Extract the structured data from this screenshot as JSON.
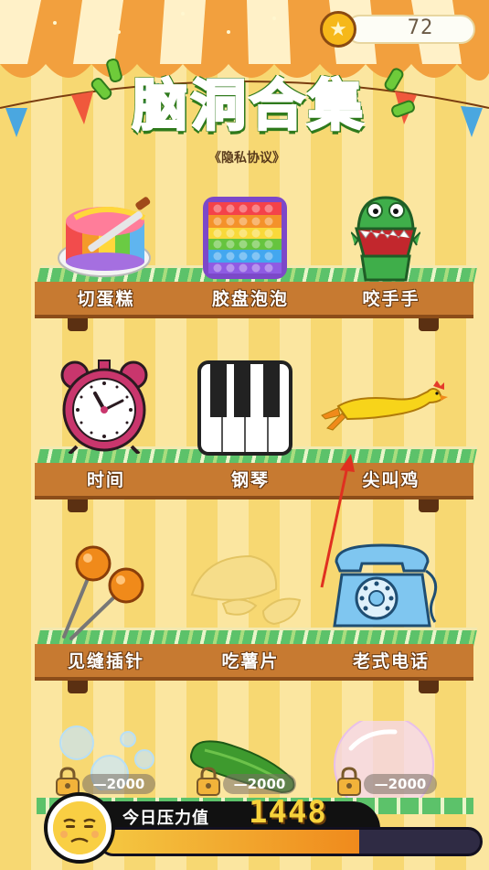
{
  "header": {
    "coins": "72",
    "title": "脑洞合集",
    "privacy_link": "《隐私协议》"
  },
  "shelves": [
    {
      "items": [
        {
          "name": "cake",
          "label": "切蛋糕"
        },
        {
          "name": "pop-it",
          "label": "胶盘泡泡"
        },
        {
          "name": "croc",
          "label": "咬手手"
        }
      ]
    },
    {
      "items": [
        {
          "name": "clock",
          "label": "时间"
        },
        {
          "name": "piano",
          "label": "钢琴"
        },
        {
          "name": "chicken",
          "label": "尖叫鸡"
        }
      ]
    },
    {
      "items": [
        {
          "name": "needle",
          "label": "见缝插针"
        },
        {
          "name": "chips",
          "label": "吃薯片"
        },
        {
          "name": "phone",
          "label": "老式电话"
        }
      ]
    }
  ],
  "locked": [
    {
      "name": "bubbles",
      "cost": "—2000"
    },
    {
      "name": "cucumber",
      "cost": "—2000"
    },
    {
      "name": "bubble-ball",
      "cost": "—2000"
    }
  ],
  "stress": {
    "label": "今日压力值",
    "value": "1448",
    "fill_fraction": 0.68
  },
  "colors": {
    "accent_green": "#6ecb3a",
    "shelf_wood": "#c77a31",
    "coin_gold": "#f6b81a",
    "pointer_red": "#e03020"
  }
}
